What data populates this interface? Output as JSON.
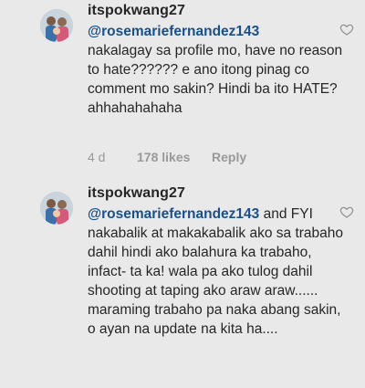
{
  "comments": [
    {
      "username": "itspokwang27",
      "mention": "@rosemariefernandez143",
      "text": "nakalagay sa profile mo, have no reason to hate?????? e ano itong pinag co comment mo sakin? Hindi ba ito HATE? ahhahahahaha",
      "age": "4 d",
      "likes": "178 likes",
      "reply": "Reply"
    },
    {
      "username": "itspokwang27",
      "mention": "@rosemariefernandez143",
      "text_after_mention": " and FYI  nakabalik at makakabalik ako sa trabaho dahil hindi ako balahura ka trabaho, infact- ta ka! wala pa ako tulog dahil shooting at taping ako araw araw...... maraming trabaho pa naka abang sakin, o ayan na update na kita ha...."
    }
  ],
  "icons": {
    "like": "heart-outline-icon",
    "avatar": "profile-photo"
  }
}
